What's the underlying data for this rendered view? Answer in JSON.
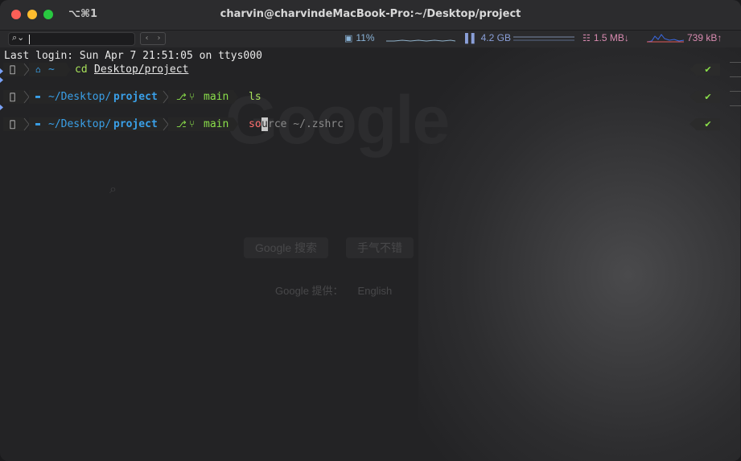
{
  "titlebar": {
    "shortcut": "⌥⌘1",
    "title": "charvin@charvindeMacBook-Pro:~/Desktop/project"
  },
  "statusbar": {
    "search_placeholder": "",
    "nav_back": "‹",
    "nav_forward": "›",
    "cpu": "11%",
    "memory": "4.2 GB",
    "network_down": "1.5 MB↓",
    "network_up": "739 kB↑"
  },
  "background": {
    "logo": "Google",
    "search_button": "Google 搜索",
    "lucky_button": "手气不错",
    "offered_prefix": "Google 提供：",
    "offered_lang": "English"
  },
  "terminal": {
    "last_login": "Last login: Sun Apr  7 21:51:05 on ttys000",
    "prompts": [
      {
        "dir_prefix": "~",
        "dir_bold": "",
        "git": false,
        "branch": "",
        "cmd": "cd",
        "arg": "Desktop/project",
        "arg_underline": true
      },
      {
        "dir_prefix": "~/Desktop/",
        "dir_bold": "project",
        "git": true,
        "branch": "main",
        "cmd": "ls",
        "arg": "",
        "arg_underline": false
      },
      {
        "dir_prefix": "~/Desktop/",
        "dir_bold": "project",
        "git": true,
        "branch": "main",
        "cmd_typed": "so",
        "cmd_cursor": "u",
        "cmd_suggestion": "rce ~/.zshrc"
      }
    ],
    "status_check": "✔"
  },
  "colors": {
    "apple_segment": "#e0e0e0",
    "dir": "#3aa0e8",
    "branch": "#8be04a",
    "cmd_ok": "#a7e05a",
    "cmd_typing": "#ff6f6f",
    "suggestion": "#8a8a8a",
    "cursor": "#c8c8c8",
    "cpu_graph": "#8fb0c8",
    "mem_graph": "#7a8aa8",
    "net_graph_down": "#3a6ae8",
    "net_graph_up": "#e05a5a",
    "cpu_text": "#8ab3d8",
    "mem_text": "#8a9fd8",
    "net_down_text": "#d88ab0",
    "net_up_text": "#d88ab0"
  }
}
